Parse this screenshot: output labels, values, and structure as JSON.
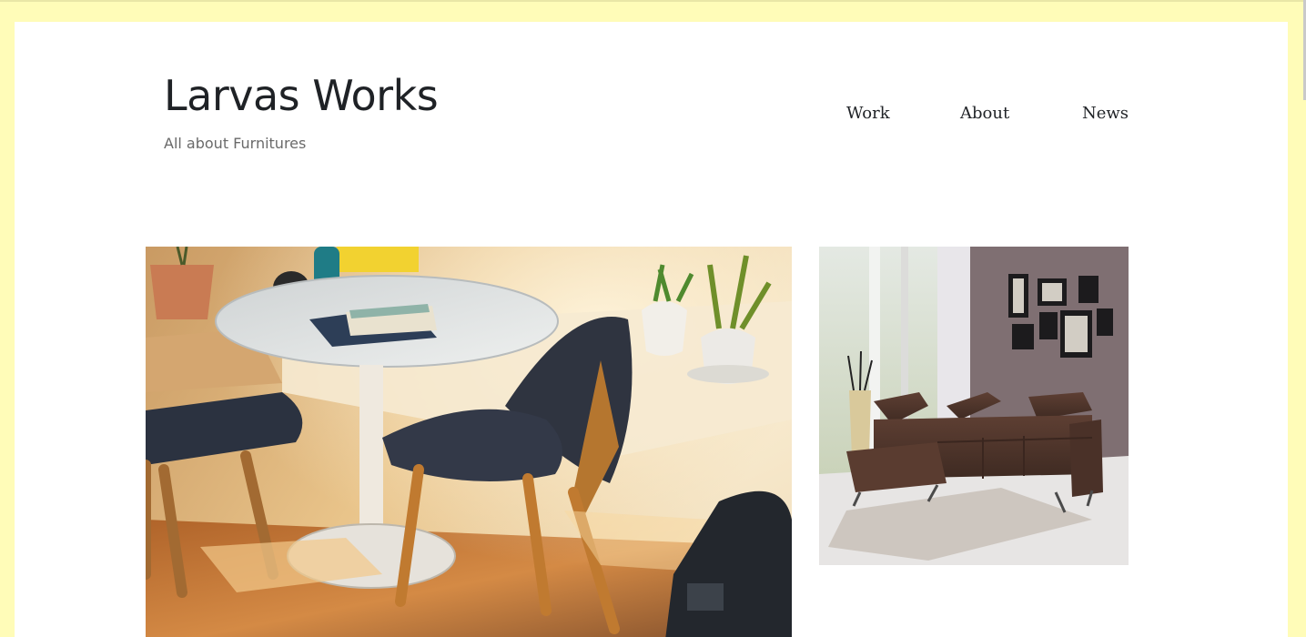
{
  "site": {
    "title": "Larvas Works",
    "tagline": "All about Furnitures"
  },
  "nav": {
    "items": [
      {
        "label": "Work"
      },
      {
        "label": "About"
      },
      {
        "label": "News"
      }
    ]
  },
  "gallery": {
    "images": [
      {
        "subject": "dining-table-with-chairs"
      },
      {
        "subject": "brown-leather-sectional-sofa"
      }
    ]
  },
  "colors": {
    "frame": "#fffcb8",
    "page": "#ffffff",
    "title": "#1f2226",
    "tagline": "#6a6a6a"
  }
}
